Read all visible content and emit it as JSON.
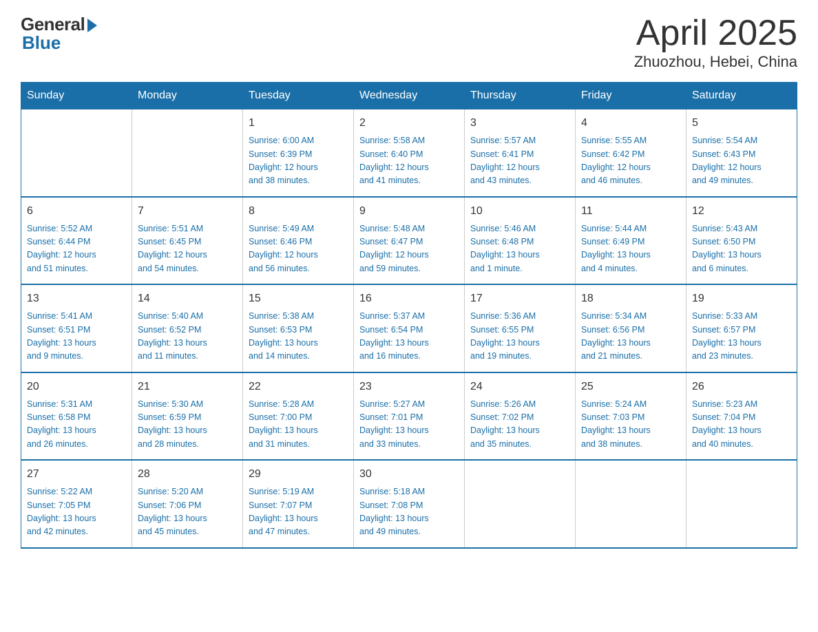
{
  "header": {
    "logo_general": "General",
    "logo_blue": "Blue",
    "title": "April 2025",
    "location": "Zhuozhou, Hebei, China"
  },
  "weekdays": [
    "Sunday",
    "Monday",
    "Tuesday",
    "Wednesday",
    "Thursday",
    "Friday",
    "Saturday"
  ],
  "weeks": [
    [
      {
        "day": "",
        "info": ""
      },
      {
        "day": "",
        "info": ""
      },
      {
        "day": "1",
        "info": "Sunrise: 6:00 AM\nSunset: 6:39 PM\nDaylight: 12 hours\nand 38 minutes."
      },
      {
        "day": "2",
        "info": "Sunrise: 5:58 AM\nSunset: 6:40 PM\nDaylight: 12 hours\nand 41 minutes."
      },
      {
        "day": "3",
        "info": "Sunrise: 5:57 AM\nSunset: 6:41 PM\nDaylight: 12 hours\nand 43 minutes."
      },
      {
        "day": "4",
        "info": "Sunrise: 5:55 AM\nSunset: 6:42 PM\nDaylight: 12 hours\nand 46 minutes."
      },
      {
        "day": "5",
        "info": "Sunrise: 5:54 AM\nSunset: 6:43 PM\nDaylight: 12 hours\nand 49 minutes."
      }
    ],
    [
      {
        "day": "6",
        "info": "Sunrise: 5:52 AM\nSunset: 6:44 PM\nDaylight: 12 hours\nand 51 minutes."
      },
      {
        "day": "7",
        "info": "Sunrise: 5:51 AM\nSunset: 6:45 PM\nDaylight: 12 hours\nand 54 minutes."
      },
      {
        "day": "8",
        "info": "Sunrise: 5:49 AM\nSunset: 6:46 PM\nDaylight: 12 hours\nand 56 minutes."
      },
      {
        "day": "9",
        "info": "Sunrise: 5:48 AM\nSunset: 6:47 PM\nDaylight: 12 hours\nand 59 minutes."
      },
      {
        "day": "10",
        "info": "Sunrise: 5:46 AM\nSunset: 6:48 PM\nDaylight: 13 hours\nand 1 minute."
      },
      {
        "day": "11",
        "info": "Sunrise: 5:44 AM\nSunset: 6:49 PM\nDaylight: 13 hours\nand 4 minutes."
      },
      {
        "day": "12",
        "info": "Sunrise: 5:43 AM\nSunset: 6:50 PM\nDaylight: 13 hours\nand 6 minutes."
      }
    ],
    [
      {
        "day": "13",
        "info": "Sunrise: 5:41 AM\nSunset: 6:51 PM\nDaylight: 13 hours\nand 9 minutes."
      },
      {
        "day": "14",
        "info": "Sunrise: 5:40 AM\nSunset: 6:52 PM\nDaylight: 13 hours\nand 11 minutes."
      },
      {
        "day": "15",
        "info": "Sunrise: 5:38 AM\nSunset: 6:53 PM\nDaylight: 13 hours\nand 14 minutes."
      },
      {
        "day": "16",
        "info": "Sunrise: 5:37 AM\nSunset: 6:54 PM\nDaylight: 13 hours\nand 16 minutes."
      },
      {
        "day": "17",
        "info": "Sunrise: 5:36 AM\nSunset: 6:55 PM\nDaylight: 13 hours\nand 19 minutes."
      },
      {
        "day": "18",
        "info": "Sunrise: 5:34 AM\nSunset: 6:56 PM\nDaylight: 13 hours\nand 21 minutes."
      },
      {
        "day": "19",
        "info": "Sunrise: 5:33 AM\nSunset: 6:57 PM\nDaylight: 13 hours\nand 23 minutes."
      }
    ],
    [
      {
        "day": "20",
        "info": "Sunrise: 5:31 AM\nSunset: 6:58 PM\nDaylight: 13 hours\nand 26 minutes."
      },
      {
        "day": "21",
        "info": "Sunrise: 5:30 AM\nSunset: 6:59 PM\nDaylight: 13 hours\nand 28 minutes."
      },
      {
        "day": "22",
        "info": "Sunrise: 5:28 AM\nSunset: 7:00 PM\nDaylight: 13 hours\nand 31 minutes."
      },
      {
        "day": "23",
        "info": "Sunrise: 5:27 AM\nSunset: 7:01 PM\nDaylight: 13 hours\nand 33 minutes."
      },
      {
        "day": "24",
        "info": "Sunrise: 5:26 AM\nSunset: 7:02 PM\nDaylight: 13 hours\nand 35 minutes."
      },
      {
        "day": "25",
        "info": "Sunrise: 5:24 AM\nSunset: 7:03 PM\nDaylight: 13 hours\nand 38 minutes."
      },
      {
        "day": "26",
        "info": "Sunrise: 5:23 AM\nSunset: 7:04 PM\nDaylight: 13 hours\nand 40 minutes."
      }
    ],
    [
      {
        "day": "27",
        "info": "Sunrise: 5:22 AM\nSunset: 7:05 PM\nDaylight: 13 hours\nand 42 minutes."
      },
      {
        "day": "28",
        "info": "Sunrise: 5:20 AM\nSunset: 7:06 PM\nDaylight: 13 hours\nand 45 minutes."
      },
      {
        "day": "29",
        "info": "Sunrise: 5:19 AM\nSunset: 7:07 PM\nDaylight: 13 hours\nand 47 minutes."
      },
      {
        "day": "30",
        "info": "Sunrise: 5:18 AM\nSunset: 7:08 PM\nDaylight: 13 hours\nand 49 minutes."
      },
      {
        "day": "",
        "info": ""
      },
      {
        "day": "",
        "info": ""
      },
      {
        "day": "",
        "info": ""
      }
    ]
  ]
}
